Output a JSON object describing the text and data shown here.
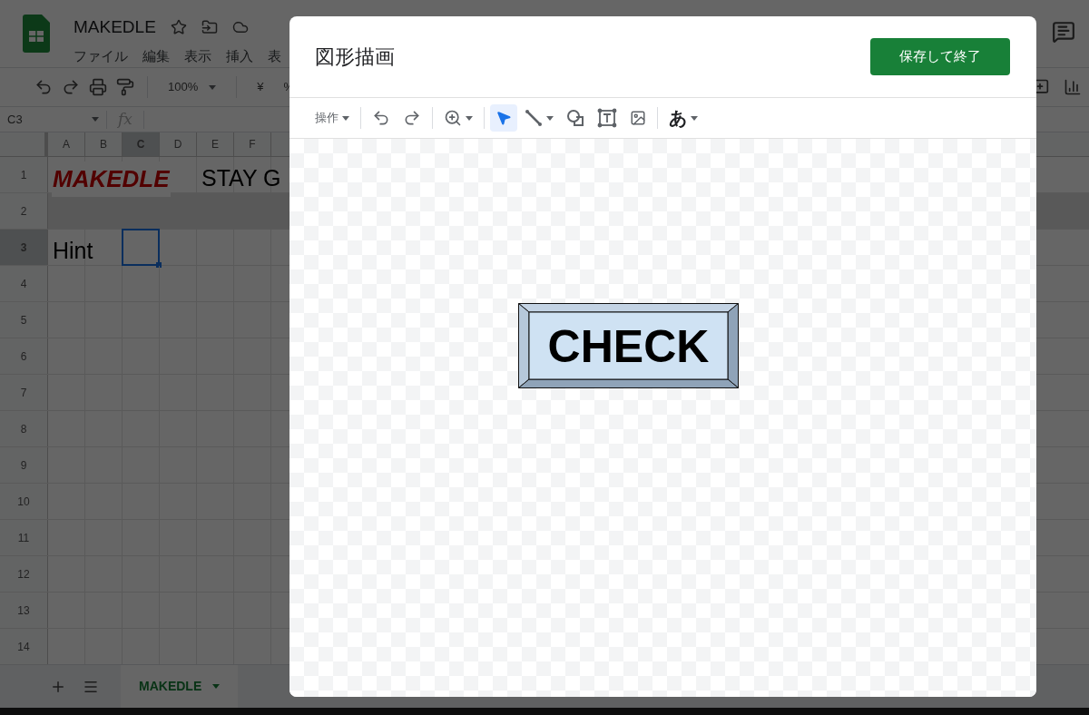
{
  "app": {
    "title": "MAKEDLE",
    "menu": [
      "ファイル",
      "編集",
      "表示",
      "挿入",
      "表"
    ]
  },
  "toolbar": {
    "zoom": "100%",
    "currency": "¥",
    "percent": "%"
  },
  "formula_bar": {
    "cell_ref": "C3",
    "fx": "fx"
  },
  "grid": {
    "columns": [
      {
        "label": "A",
        "selected": false
      },
      {
        "label": "B",
        "selected": false
      },
      {
        "label": "C",
        "selected": true
      },
      {
        "label": "D",
        "selected": false
      },
      {
        "label": "E",
        "selected": false
      },
      {
        "label": "F",
        "selected": false
      }
    ],
    "rows": [
      {
        "label": "1",
        "selected": false,
        "cells": [
          {
            "kind": "title",
            "text": "MAKEDLE"
          },
          {
            "kind": "empty"
          },
          {
            "kind": "empty"
          },
          {
            "kind": "empty"
          },
          {
            "kind": "text",
            "text": "STAY G"
          }
        ]
      },
      {
        "label": "2",
        "selected": false
      },
      {
        "label": "3",
        "selected": true,
        "cells": [
          {
            "kind": "text",
            "text": "Hint"
          }
        ]
      },
      {
        "label": "4",
        "selected": false
      },
      {
        "label": "5",
        "selected": false
      },
      {
        "label": "6",
        "selected": false
      },
      {
        "label": "7",
        "selected": false
      },
      {
        "label": "8",
        "selected": false
      },
      {
        "label": "9",
        "selected": false
      },
      {
        "label": "10",
        "selected": false
      },
      {
        "label": "11",
        "selected": false
      },
      {
        "label": "12",
        "selected": false
      },
      {
        "label": "13",
        "selected": false
      },
      {
        "label": "14",
        "selected": false
      }
    ]
  },
  "sheet_tabs": [
    {
      "label": "MAKEDLE",
      "selected": true
    }
  ],
  "dialog": {
    "title": "図形描画",
    "save_button": "保存して終了",
    "tools": [
      {
        "kind": "menu",
        "label": "操作",
        "selected": false
      },
      {
        "kind": "undo",
        "selected": false
      },
      {
        "kind": "redo",
        "selected": false
      },
      {
        "kind": "zoom",
        "selected": false
      },
      {
        "kind": "select",
        "selected": true
      },
      {
        "kind": "line",
        "selected": false
      },
      {
        "kind": "shape",
        "selected": false
      },
      {
        "kind": "textbox",
        "selected": false
      },
      {
        "kind": "image",
        "selected": false
      },
      {
        "kind": "font",
        "label": "あ",
        "selected": false
      }
    ],
    "shape_text": "CHECK"
  }
}
